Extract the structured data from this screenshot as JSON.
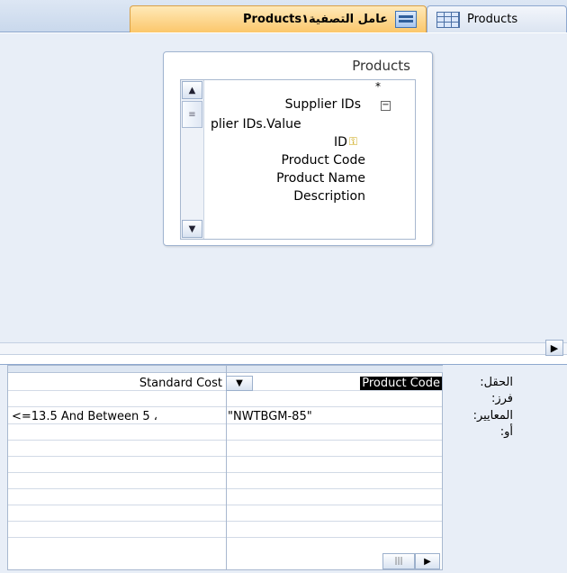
{
  "tabs": [
    {
      "label": "Products",
      "icon": "table-icon"
    },
    {
      "label": "Productsعامل التصفية١",
      "icon": "query-design-icon"
    }
  ],
  "design": {
    "table": {
      "title": "Products",
      "fields": {
        "star": "*",
        "supplier_ids": "Supplier IDs",
        "supplier_ids_toggle": "⊟",
        "supplier_ids_value": "plier IDs.Value",
        "id": "ID",
        "product_code": "Product Code",
        "product_name": "Product Name",
        "description": "Description"
      }
    }
  },
  "grid": {
    "row_labels": {
      "field": "الحقل:",
      "sort": "فرز:",
      "criteria": "المعايير:",
      "or": "أو:"
    },
    "columns": [
      {
        "field": "Product Code",
        "criteria": "\"NWTBGM-85\""
      },
      {
        "field": "Standard Cost",
        "criteria": "<=13.5 And Between 5 ،"
      }
    ]
  },
  "glyphs": {
    "up": "▲",
    "down": "▼",
    "thumb": "≡",
    "right": "▶",
    "key": "🔑",
    "hthumb": "|||"
  }
}
